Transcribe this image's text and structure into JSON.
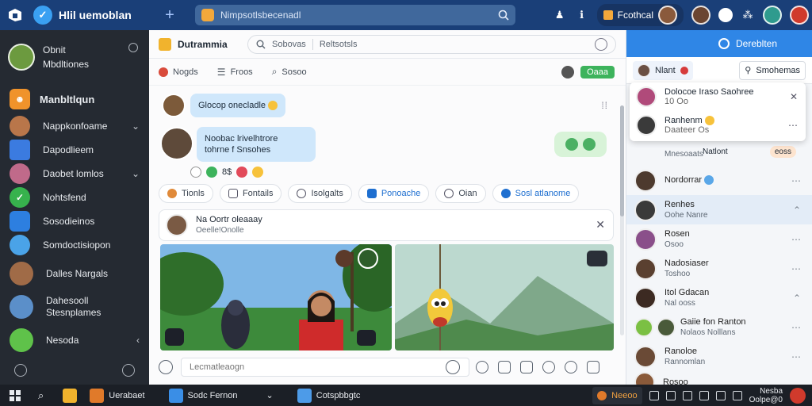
{
  "topbar": {
    "app_title": "Hlil uemoblan",
    "search_placeholder": "Nimpsotlsbecenadl",
    "pill_label": "Fcothcal"
  },
  "sidebar": {
    "profile": {
      "line1": "Obnit",
      "line2": "Mbdltiones"
    },
    "items": [
      {
        "label": "Manbltlqun",
        "featured": true
      },
      {
        "label": "Nappkonfoame",
        "chevron": true
      },
      {
        "label": "Dapodlieem"
      },
      {
        "label": "Daobet lomlos",
        "chevron": true
      },
      {
        "label": "Nohtsfend"
      },
      {
        "label": "Sosodieinos"
      },
      {
        "label": "Somdoctisiopon"
      },
      {
        "label": "Dalles Nargals"
      },
      {
        "label": "Dahesooll Stesnplames"
      },
      {
        "label": "Nesoda",
        "chevron": true
      }
    ]
  },
  "main": {
    "title": "Dutrammia",
    "search_a": "Sobovas",
    "search_b": "Reltsotsls",
    "tabs": [
      "Nogds",
      "Froos",
      "Sosoo"
    ],
    "status_label": "Oaaa",
    "messages": [
      {
        "text": "Glocop onecladle"
      },
      {
        "line1": "Noobac lrivelhtrore",
        "line2": "tohrne f Snsohes"
      }
    ],
    "reaction_count": "8$",
    "actions": [
      "Tionls",
      "Fontails",
      "Isolgalts",
      "Ponoache",
      "Oian",
      "Sosl atlanome"
    ],
    "post_title": "Na Oortr oleaaay",
    "post_meta": "Oeelle!Onolle",
    "composer_placeholder": "Lecmatleaogn"
  },
  "right": {
    "header_title": "Dereblten",
    "tab_active": "Nlant",
    "tab_right": "Smohemas",
    "popup": [
      {
        "title": "Dolocoe Iraso Saohree",
        "sub": "10 Oo"
      },
      {
        "title": "Ranhenm",
        "sub": "Daateer Os"
      }
    ],
    "list": [
      {
        "title": "Natlont",
        "sub": "Mnesoaats",
        "extra": "eoss"
      },
      {
        "title": "Nordorrar",
        "sub": "",
        "highlight": false
      },
      {
        "title": "Renhes",
        "sub": "Oohe Nanre",
        "highlight": true
      },
      {
        "title": "Rosen",
        "sub": "Osoo"
      },
      {
        "title": "Nadosiaser",
        "sub": "Toshoo"
      },
      {
        "title": "Itol Gdacan",
        "sub": "Nal ooss"
      },
      {
        "title": "Gaiie fon Ranton",
        "sub": "Nolaos Nolllans"
      },
      {
        "title": "Ranoloe",
        "sub": "Rannomlan"
      },
      {
        "title": "Rosoo",
        "sub": ""
      }
    ]
  },
  "taskbar": {
    "app1": "Uerabaet",
    "app2": "Sodc Fernon",
    "app3": "Cotspbbgtc",
    "tray_app": "Neeoo",
    "time": "Nesba",
    "date": "Oolpe@0"
  },
  "colors": {
    "topbar": "#1a3f78",
    "sidebar": "#252a32",
    "accent": "#2f86e6",
    "bubble": "#cfe7fb",
    "online": "#3db35c"
  }
}
